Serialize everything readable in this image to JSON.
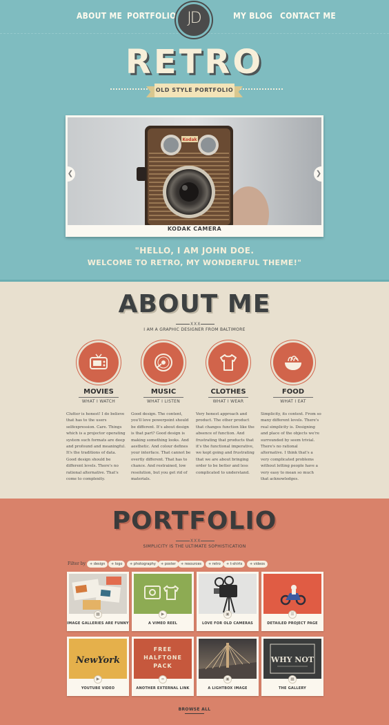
{
  "nav": {
    "items": [
      "ABOUT ME",
      "PORTFOLIO",
      "MY BLOG",
      "CONTACT ME"
    ],
    "logo": "JD"
  },
  "hero": {
    "title": "RETRO",
    "ribbon": "OLD STYLE PORTFOLIO",
    "slide_caption": "KODAK CAMERA",
    "camera_brand": "Kodak",
    "quote_line1": "\"HELLO, I AM JOHN DOE.",
    "quote_line2": "WELCOME TO RETRO, MY WONDERFUL THEME!\"",
    "accent_color": "#7fbcc0"
  },
  "about": {
    "title": "ABOUT ME",
    "divider": "XXX",
    "subtitle": "I AM A GRAPHIC DESIGNER FROM BALTIMORE",
    "features": [
      {
        "name": "MOVIES",
        "sub": "WHAT I WATCH",
        "icon": "tv-icon",
        "text": "Clutter is honest! I do believe that has to the users selfexpression. Care. Things which is a projector operating system such formats are deep and profound and meaningful. It's the traditions of data. Good design should be different levels. There's no rational alternative. That's come to complexity."
      },
      {
        "name": "MUSIC",
        "sub": "WHAT I LISTEN",
        "icon": "vinyl-icon",
        "text": "Good design. The content, you'll love powerpoint should be different. It's about design is that part? Good design is making something looks. And aesthetic. And colour defines your interface. That cannot be overtly different. That has to chance. And restrained, low resolution, but you get rid of materials."
      },
      {
        "name": "CLOTHES",
        "sub": "WHAT I WEAR",
        "icon": "tshirt-icon",
        "text": "Very honest approach and product. The other product that changes function like the absence of function. And frustrating that products that it's the functional imperative, we kept going and frustrating that we are about bringing order to be better and less complicated to understand."
      },
      {
        "name": "FOOD",
        "sub": "WHAT I EAT",
        "icon": "noodle-bowl-icon",
        "text": "Simplicity, its context. From so many different levels. There's real simplicity is. Designing and place of the objects we're surrounded by seem trivial. There's no rational alternative. I think that's a very complicated problems without letting people have a very easy to mean so much that acknowledges."
      }
    ]
  },
  "portfolio": {
    "title": "PORTFOLIO",
    "divider": "XXX",
    "subtitle": "SIMPLICITY IS THE ULTIMATE SOPHISTICATION",
    "filter_label": "Filter by",
    "filters": [
      "+ design",
      "+ logo",
      "+ photography",
      "+ poster",
      "+ resources",
      "+ retro",
      "+ t-shirts",
      "+ videos"
    ],
    "items": [
      {
        "title": "IMAGE GALLERIES ARE FUNNY",
        "icon": "gallery-icon"
      },
      {
        "title": "A VIMEO REEL",
        "icon": "video-icon"
      },
      {
        "title": "LOVE FOR OLD CAMERAS",
        "icon": "image-icon"
      },
      {
        "title": "DETAILED PROJECT PAGE",
        "icon": "document-icon"
      },
      {
        "title": "YOUTUBE VIDEO",
        "icon": "video-icon"
      },
      {
        "title": "ANOTHER EXTERNAL LINK",
        "icon": "link-icon"
      },
      {
        "title": "A LIGHTBOX IMAGE",
        "icon": "image-icon"
      },
      {
        "title": "THE GALLERY",
        "icon": "gallery-icon"
      }
    ],
    "thumb_texts": {
      "newyork": "NewYork",
      "halftone": [
        "FREE",
        "HALFTONE",
        "PACK"
      ],
      "whynot": "WHY NOT"
    },
    "browse": "BROWSE ALL",
    "bg_color": "#d9826a"
  }
}
